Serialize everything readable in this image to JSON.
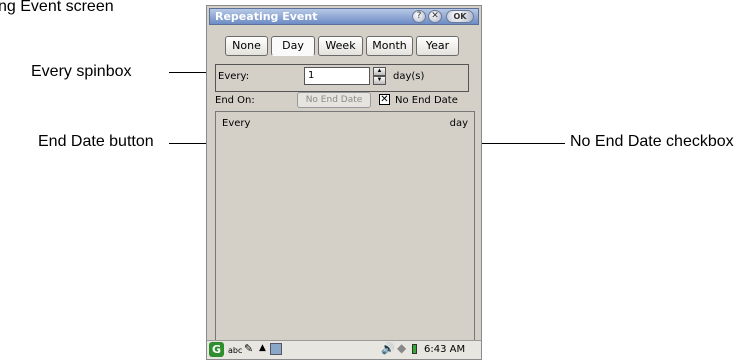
{
  "caption_fragment": "ng Event screen",
  "callouts": {
    "every_spinbox": "Every spinbox",
    "end_date_button": "End Date button",
    "no_end_date_checkbox": "No End Date checkbox"
  },
  "window": {
    "title": "Repeating Event",
    "help_glyph": "?",
    "close_glyph": "✕",
    "ok_label": "OK"
  },
  "tabs": [
    {
      "label": "None",
      "active": false
    },
    {
      "label": "Day",
      "active": true
    },
    {
      "label": "Week",
      "active": false
    },
    {
      "label": "Month",
      "active": false
    },
    {
      "label": "Year",
      "active": false
    }
  ],
  "every": {
    "label": "Every:",
    "value": "1",
    "unit": "day(s)"
  },
  "end_on": {
    "label": "End On:",
    "button_label": "No End Date",
    "checkbox_checked": true,
    "checkbox_mark": "✕",
    "checkbox_label": "No End Date"
  },
  "summary": {
    "left": "Every",
    "right": "day"
  },
  "statusbar": {
    "input_mode": "abc",
    "time": "6:43 AM"
  },
  "colors": {
    "frame_bg": "#d4d0c8",
    "titlebar": "#6d8cc4",
    "logo_green": "#2f8f2f"
  },
  "icons": [
    "g-logo-icon",
    "pen-icon",
    "arrow-up-icon",
    "keyboard-icon",
    "speaker-icon",
    "diamond-icon",
    "battery-icon"
  ]
}
